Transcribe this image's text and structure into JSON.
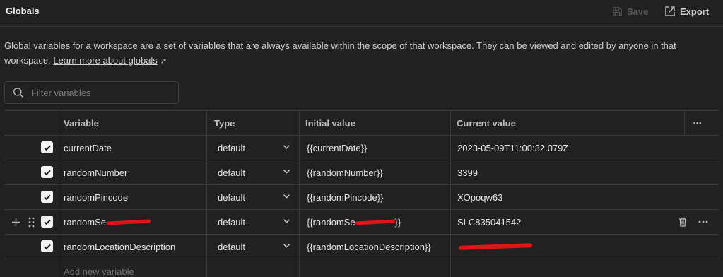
{
  "header": {
    "title": "Globals",
    "save_label": "Save",
    "export_label": "Export"
  },
  "description": {
    "text": "Global variables for a workspace are a set of variables that are always available within the scope of that workspace. They can be viewed and edited by anyone in that workspace.",
    "link_label": "Learn more about globals",
    "link_arrow": "↗"
  },
  "filter": {
    "placeholder": "Filter variables"
  },
  "table": {
    "columns": {
      "variable": "Variable",
      "type": "Type",
      "initial_value": "Initial value",
      "current_value": "Current value",
      "more": "•••"
    },
    "rows": [
      {
        "variable": "currentDate",
        "type": "default",
        "initial": "{{currentDate}}",
        "current": "2023-05-09T11:00:32.079Z"
      },
      {
        "variable": "randomNumber",
        "type": "default",
        "initial": "{{randomNumber}}",
        "current": "3399"
      },
      {
        "variable": "randomPincode",
        "type": "default",
        "initial": "{{randomPincode}}",
        "current": "XOpoqw63"
      },
      {
        "variable": "randomSe",
        "type": "default",
        "initial": "{{randomSe",
        "initial_suffix": "}}",
        "current": "SLC835041542"
      },
      {
        "variable": "randomLocationDescription",
        "type": "default",
        "initial": "{{randomLocationDescription}}",
        "current": ""
      }
    ],
    "add_placeholder": "Add new variable"
  },
  "icons": {
    "save": "save-icon",
    "export": "export-icon",
    "search": "search-icon",
    "checkbox": "checkbox-checked-icon",
    "chevron": "chevron-down-icon",
    "add": "plus-icon",
    "drag": "drag-handle-icon",
    "delete": "trash-icon",
    "more": "more-horizontal-icon"
  },
  "colors": {
    "background": "#212121",
    "border": "#383838",
    "redaction": "#e01515"
  }
}
